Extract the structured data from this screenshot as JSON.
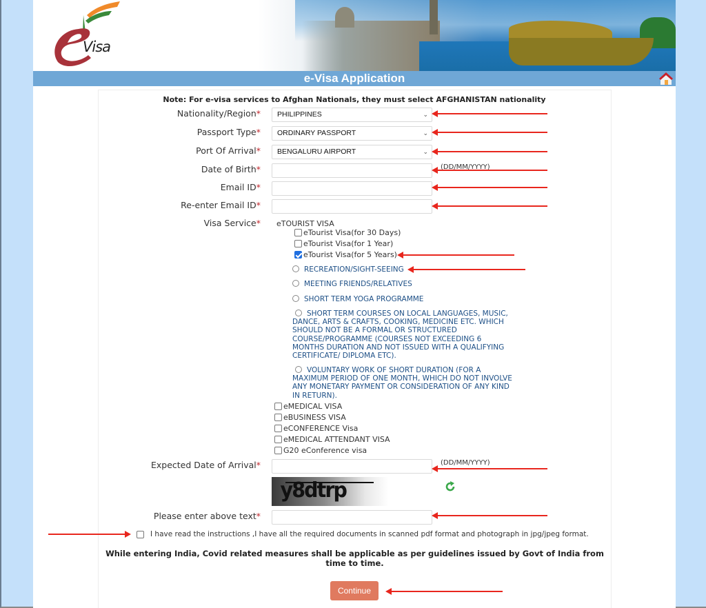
{
  "header": {
    "logo_text": "Visa",
    "title": "e-Visa Application",
    "home_icon": "home-icon"
  },
  "form": {
    "note": "Note: For e-visa services to Afghan Nationals, they must select AFGHANISTAN nationality",
    "required_mark": "*",
    "fields": {
      "nationality": {
        "label": "Nationality/Region",
        "value": "PHILIPPINES"
      },
      "passport_type": {
        "label": "Passport Type",
        "value": "ORDINARY PASSPORT"
      },
      "port_of_arrival": {
        "label": "Port Of Arrival",
        "value": "BENGALURU AIRPORT"
      },
      "date_of_birth": {
        "label": "Date of Birth",
        "value": "",
        "hint": "(DD/MM/YYYY)"
      },
      "email": {
        "label": "Email ID",
        "value": ""
      },
      "reenter_email": {
        "label": "Re-enter Email ID",
        "value": ""
      },
      "expected_arrival": {
        "label": "Expected Date of Arrival",
        "value": "",
        "hint": "(DD/MM/YYYY)"
      },
      "captcha_input": {
        "label": "Please enter above text",
        "value": ""
      }
    },
    "visa_service": {
      "label": "Visa Service",
      "group_title": "eTOURIST VISA",
      "etourist_options": [
        {
          "label": "eTourist Visa(for 30 Days)",
          "checked": false
        },
        {
          "label": "eTourist Visa(for 1 Year)",
          "checked": false
        },
        {
          "label": "eTourist Visa(for 5 Years)",
          "checked": true
        }
      ],
      "purposes": [
        {
          "label": "RECREATION/SIGHT-SEEING",
          "selected": false
        },
        {
          "label": "MEETING FRIENDS/RELATIVES",
          "selected": false
        },
        {
          "label": "SHORT TERM YOGA PROGRAMME",
          "selected": false
        },
        {
          "label": "SHORT TERM COURSES ON LOCAL LANGUAGES, MUSIC, DANCE, ARTS & CRAFTS, COOKING, MEDICINE ETC. WHICH SHOULD NOT BE A FORMAL OR STRUCTURED COURSE/PROGRAMME (COURSES NOT EXCEEDING 6 MONTHS DURATION AND NOT ISSUED WITH A QUALIFYING CERTIFICATE/ DIPLOMA ETC).",
          "selected": false
        },
        {
          "label": "VOLUNTARY WORK OF SHORT DURATION (FOR A MAXIMUM PERIOD OF ONE MONTH, WHICH DO NOT INVOLVE ANY MONETARY PAYMENT OR CONSIDERATION OF ANY KIND IN RETURN).",
          "selected": false
        }
      ],
      "other_visas": [
        {
          "label": "eMEDICAL VISA",
          "checked": false
        },
        {
          "label": "eBUSINESS VISA",
          "checked": false
        },
        {
          "label": "eCONFERENCE Visa",
          "checked": false
        },
        {
          "label": "eMEDICAL ATTENDANT VISA",
          "checked": false
        },
        {
          "label": "G20 eConference visa",
          "checked": false
        }
      ]
    },
    "captcha": {
      "text": "y8dtrp",
      "refresh_icon": "refresh-icon"
    },
    "agreement": {
      "label": "I have read the instructions ,I have all the required documents in scanned pdf format and photograph in jpg/jpeg format.",
      "checked": false
    },
    "covid_notice": "While entering India, Covid related measures shall be applicable as per guidelines issued by Govt of India from time to time.",
    "continue_label": "Continue"
  },
  "colors": {
    "page_bg": "#c4e0fa",
    "titlebar": "#6fa7d6",
    "required": "#c0272d",
    "purpose_text": "#1d4f86",
    "continue_button": "#e07a5f",
    "annotation_arrow": "#e8261d"
  }
}
